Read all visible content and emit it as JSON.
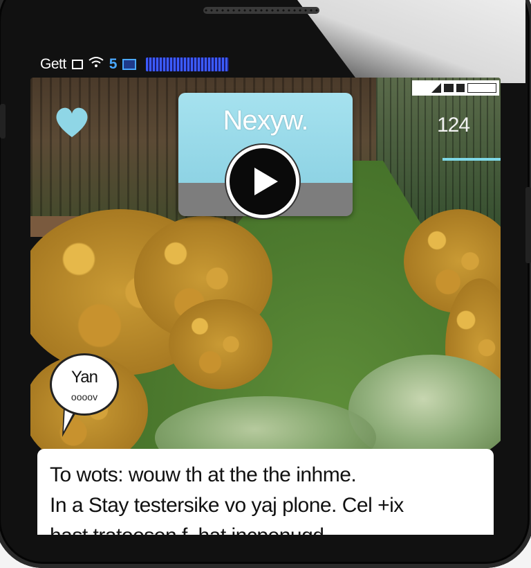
{
  "status_bar": {
    "carrier": "Gett",
    "indicator_text": "5"
  },
  "video": {
    "title": "Nexyw."
  },
  "top_right": {
    "counter": "124"
  },
  "speech_bubble": {
    "name": "Yan",
    "subtext": "oooov"
  },
  "message": {
    "lines": [
      "To wots: wouw th at the the inhme.",
      "In a Stay testersike vo yaj plone. Cel +ix",
      "hast tratoesen f. hat incpenuqd"
    ]
  },
  "colors": {
    "accent_cyan": "#8fd6e6",
    "video_bottom_gray": "#7d7d7d",
    "phone_black": "#111111"
  },
  "icons": [
    "wifi-icon",
    "battery-icon",
    "play-icon",
    "heart-icon",
    "signal-icon"
  ]
}
